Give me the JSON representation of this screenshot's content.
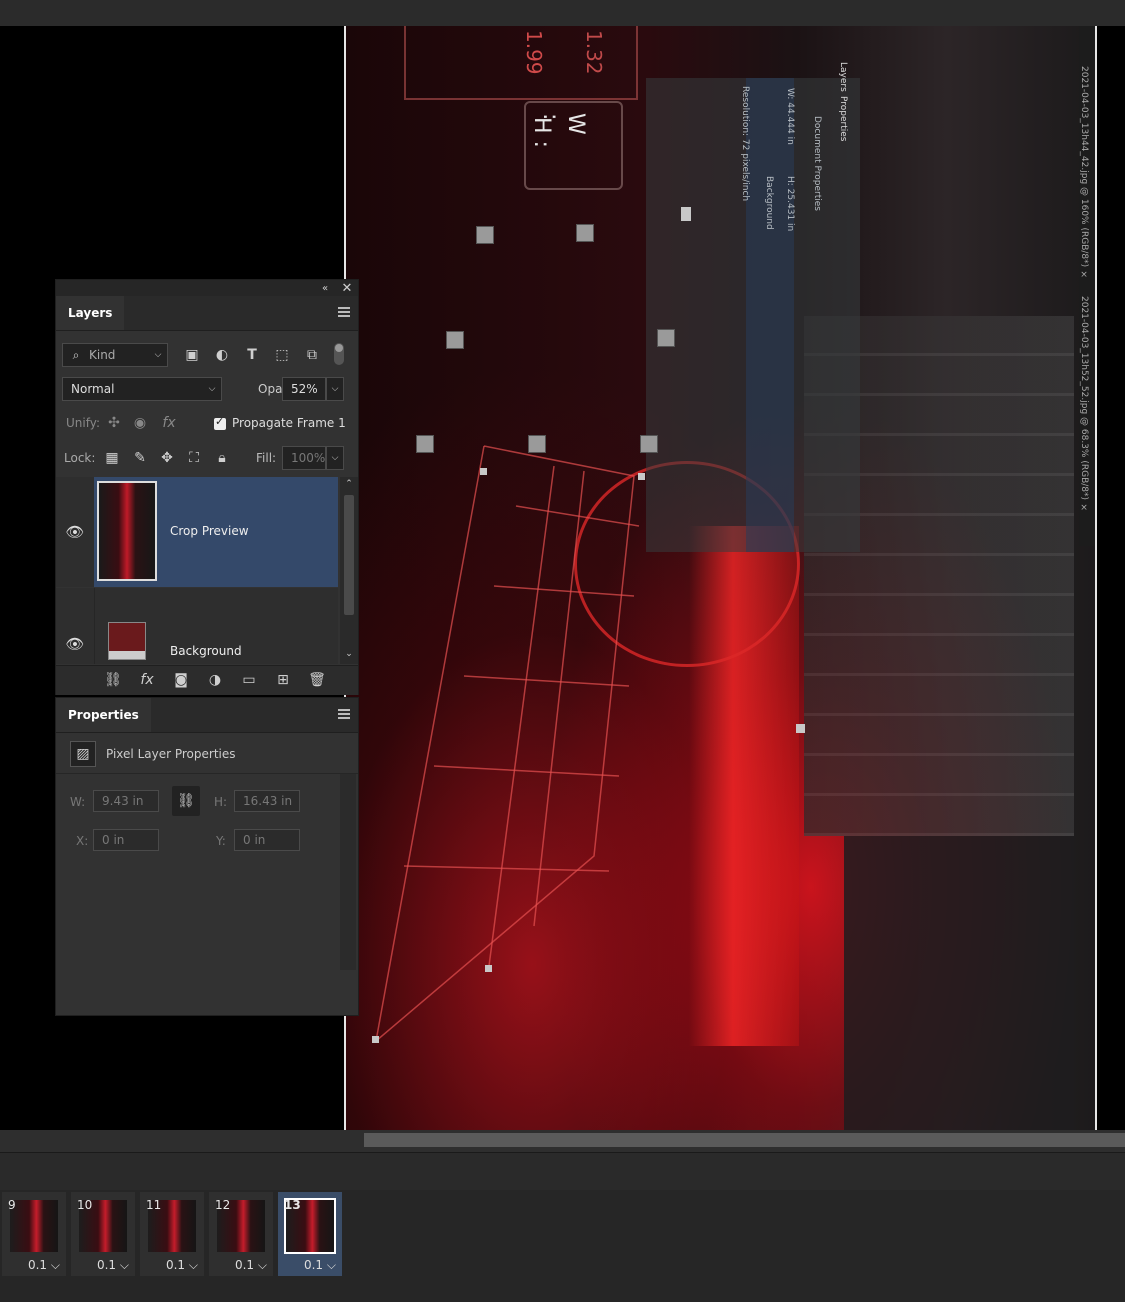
{
  "canvas": {
    "sign_text": [
      "W :",
      "H :"
    ],
    "sign_numbers": [
      "1.99",
      "1.32"
    ],
    "ghost_panel": {
      "tabs": [
        "Layers",
        "Properties"
      ],
      "w_label": "W: 44.444 in",
      "h_label": "H: 25.431 in",
      "resolution": "Resolution: 72 pixels/inch",
      "doc_props": "Document Properties",
      "background": "Background"
    },
    "tabs": [
      "2021-04-03_13h44_42.jpg @ 160% (RGB/8*) ×",
      "2021-04-03_13h52_52.jpg @ 68.3% (RGB/8*) ×"
    ]
  },
  "layers_panel": {
    "tab_label": "Layers",
    "filter": {
      "kind_label": "Kind"
    },
    "blend_mode": "Normal",
    "opacity_label": "Opacity:",
    "opacity_value": "52%",
    "unify_label": "Unify:",
    "propagate_label": "Propagate Frame 1",
    "propagate_checked": true,
    "lock_label": "Lock:",
    "fill_label": "Fill:",
    "fill_value": "100%",
    "layers": [
      {
        "name": "Crop Preview",
        "selected": true,
        "visible": true
      },
      {
        "name": "Background",
        "selected": false,
        "visible": true
      }
    ]
  },
  "properties_panel": {
    "tab_label": "Properties",
    "section_title": "Pixel Layer Properties",
    "w_label": "W:",
    "w_value": "9.43 in",
    "h_label": "H:",
    "h_value": "16.43 in",
    "x_label": "X:",
    "x_value": "0 in",
    "y_label": "Y:",
    "y_value": "0 in"
  },
  "timeline": {
    "frames": [
      {
        "number": "9",
        "duration": "0.1",
        "selected": false
      },
      {
        "number": "10",
        "duration": "0.1",
        "selected": false
      },
      {
        "number": "11",
        "duration": "0.1",
        "selected": false
      },
      {
        "number": "12",
        "duration": "0.1",
        "selected": false
      },
      {
        "number": "13",
        "duration": "0.1",
        "selected": true
      }
    ]
  },
  "colors": {
    "panel_bg": "#323232",
    "selected_layer": "#34496a",
    "accent_red": "#d8202c"
  },
  "icons": [
    "search-icon",
    "image-filter-icon",
    "adjustment-filter-icon",
    "type-filter-icon",
    "shape-filter-icon",
    "smart-object-filter-icon",
    "filter-toggle-icon",
    "chevron-down-icon",
    "eye-icon",
    "link-icon",
    "fx-icon",
    "mask-icon",
    "new-fill-layer-icon",
    "folder-icon",
    "new-layer-icon",
    "trash-icon",
    "lock-pixels-icon",
    "brush-lock-icon",
    "move-lock-icon",
    "artboard-lock-icon",
    "lock-all-icon",
    "panel-menu-icon",
    "close-icon",
    "collapse-icon",
    "pixel-layer-icon",
    "chain-link-icon"
  ]
}
